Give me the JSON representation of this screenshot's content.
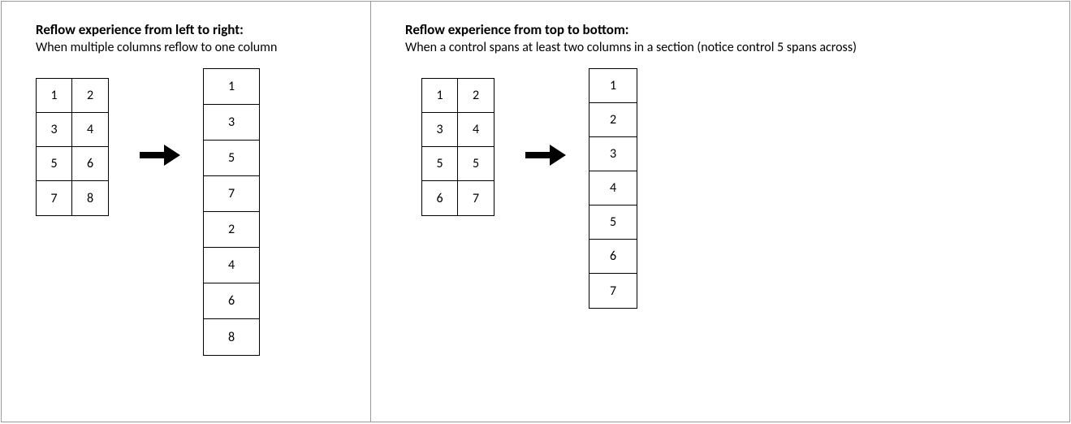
{
  "left": {
    "title": "Reflow experience from left to right:",
    "subtitle": "When multiple columns reflow to one column",
    "source_grid": [
      "1",
      "2",
      "3",
      "4",
      "5",
      "6",
      "7",
      "8"
    ],
    "result_list": [
      "1",
      "3",
      "5",
      "7",
      "2",
      "4",
      "6",
      "8"
    ]
  },
  "right": {
    "title": "Reflow experience from top to bottom:",
    "subtitle": "When a control spans at least two columns in a section (notice control 5 spans across)",
    "source_grid": [
      "1",
      "2",
      "3",
      "4",
      "5",
      "5",
      "6",
      "7"
    ],
    "result_list": [
      "1",
      "2",
      "3",
      "4",
      "5",
      "6",
      "7"
    ]
  }
}
